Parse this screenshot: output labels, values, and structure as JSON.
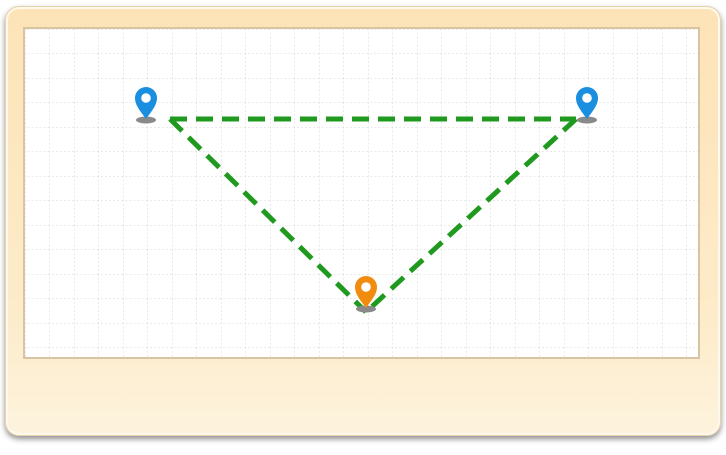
{
  "diagram": {
    "colors": {
      "card_top": "#fde3b7",
      "card_bottom": "#fdf3dd",
      "grid_line": "#c9c9c9",
      "path": "#1f9a1f",
      "pin_blue": "#1a8fe0",
      "pin_orange": "#f28c0f",
      "pin_shadow": "#8a8a8a"
    },
    "pins": [
      {
        "name": "map-pin-left-icon",
        "color": "blue"
      },
      {
        "name": "map-pin-right-icon",
        "color": "blue"
      },
      {
        "name": "map-pin-bottom-icon",
        "color": "orange"
      }
    ],
    "path": {
      "style": "dashed",
      "shape": "triangle"
    }
  }
}
